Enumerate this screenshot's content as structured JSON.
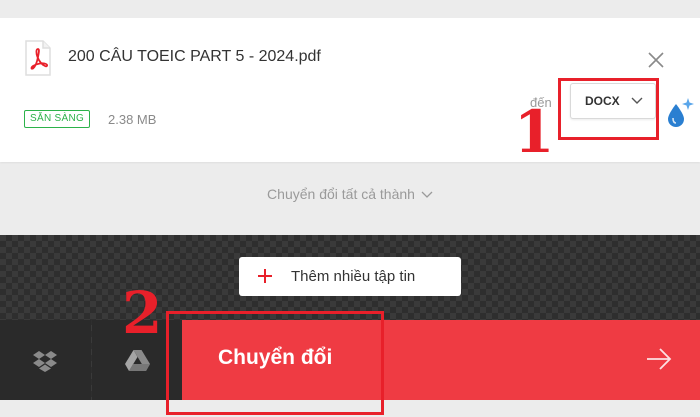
{
  "file": {
    "name": "200 CÂU TOEIC PART 5 - 2024.pdf",
    "status": "SẴN SÀNG",
    "size": "2.38 MB",
    "to_label": "đến",
    "format": "DOCX"
  },
  "convert_all": {
    "label": "Chuyển đổi tất cả thành"
  },
  "add_files": {
    "label": "Thêm nhiều tập tin"
  },
  "convert": {
    "label": "Chuyển đổi"
  },
  "annotations": {
    "step_1": "1",
    "step_2": "2"
  },
  "colors": {
    "accent": "#ef3b43",
    "annotation": "#e8202a",
    "status_green": "#2cb24a",
    "pdf_red": "#e8202a",
    "dark_panel": "#3a3a3a"
  },
  "icons": {
    "pdf": "pdf-file-icon",
    "close": "close-icon",
    "format_chevron": "chevron-down-icon",
    "drop": "droplet-sparkle-icon",
    "convert_all_chevron": "chevron-down-icon",
    "add": "plus-icon",
    "dropbox": "dropbox-icon",
    "gdrive": "google-drive-icon",
    "convert_arrow": "arrow-right-icon"
  }
}
